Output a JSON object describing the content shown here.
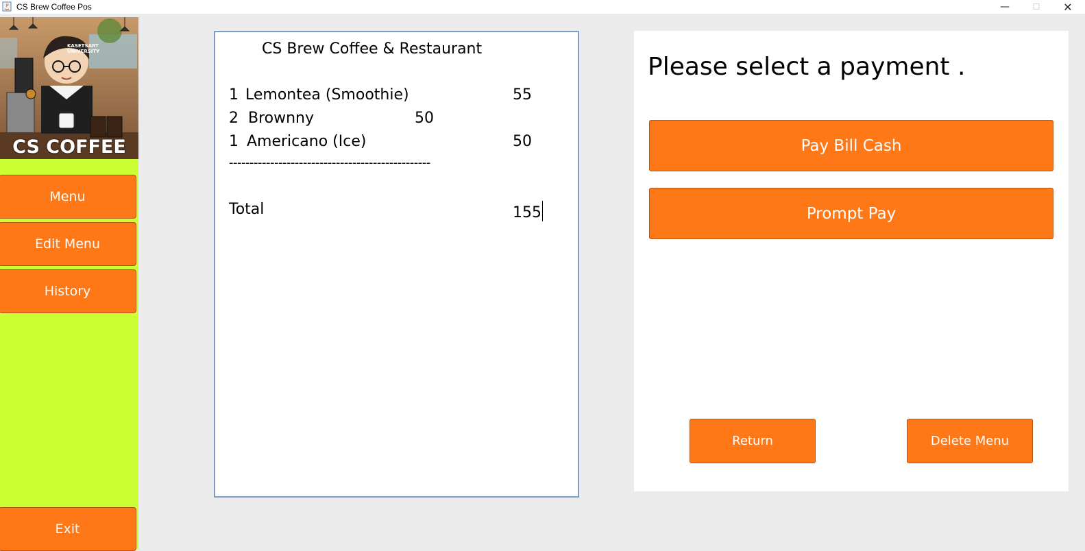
{
  "window": {
    "title": "CS Brew Coffee Pos",
    "controls": {
      "minimize": "—",
      "maximize": "☐",
      "close": "✕"
    }
  },
  "sidebar": {
    "logo": {
      "brand_text": "CS COFFEE",
      "sub_text": "KASETSART UNIVERSITY"
    },
    "buttons": [
      {
        "label": "Menu"
      },
      {
        "label": "Edit Menu"
      },
      {
        "label": "History"
      }
    ],
    "exit_label": "Exit"
  },
  "receipt": {
    "header": "CS Brew Coffee & Restaurant",
    "items": [
      {
        "qty": "1",
        "name": "Lemontea (Smoothie)",
        "price": "55"
      },
      {
        "qty": "2",
        "name": "Brownny",
        "price": "50"
      },
      {
        "qty": "1",
        "name": "Americano (Ice)",
        "price": "50"
      }
    ],
    "separator": "-------------------------------------------------",
    "total_label": "Total",
    "total_value": "155"
  },
  "payment": {
    "prompt": "Please select a payment .",
    "pay_cash_label": "Pay Bill Cash",
    "prompt_pay_label": "Prompt Pay",
    "return_label": "Return",
    "delete_menu_label": "Delete Menu"
  },
  "colors": {
    "accent_orange": "#ff7818",
    "sidebar_green": "#ccff33",
    "receipt_border": "#7a9cc6"
  }
}
